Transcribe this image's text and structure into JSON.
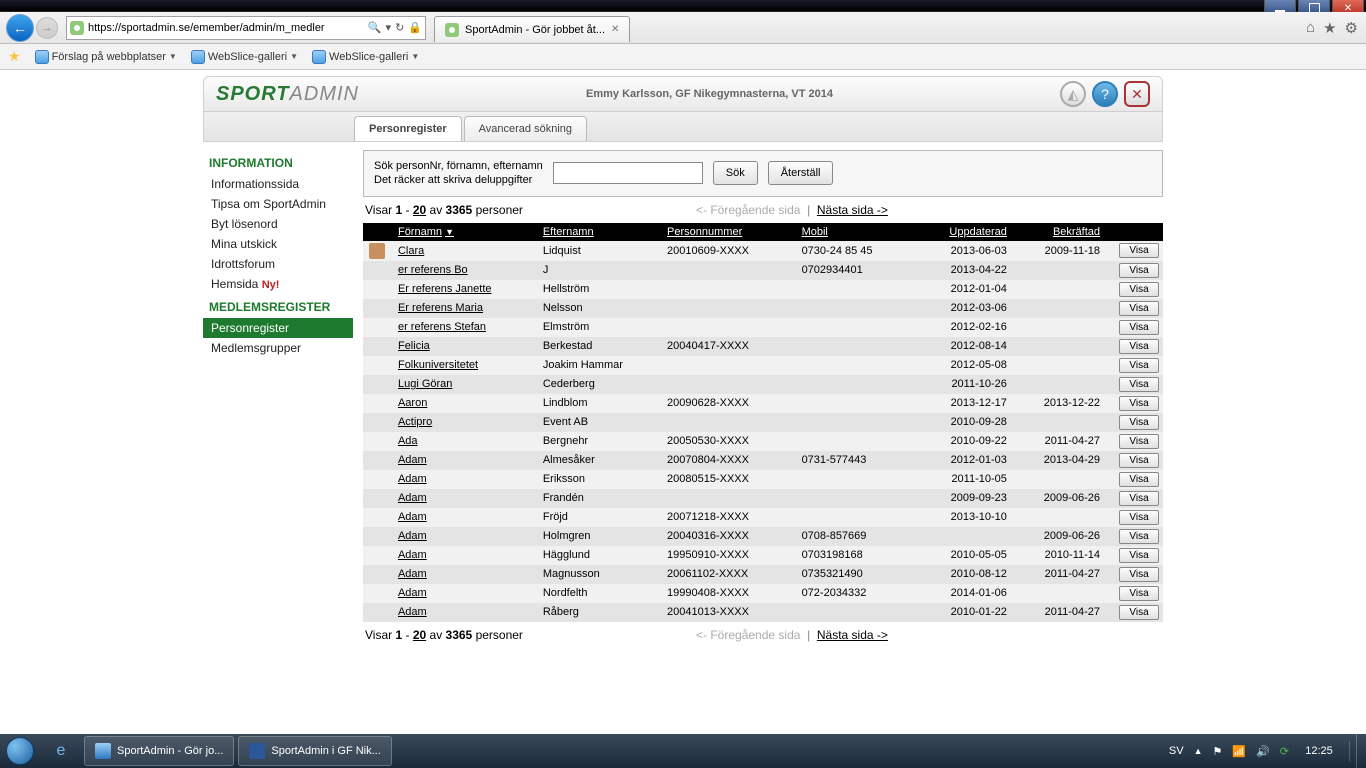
{
  "browser": {
    "url": "https://sportadmin.se/emember/admin/m_medler",
    "tab_title": "SportAdmin - Gör jobbet åt..."
  },
  "favorites": {
    "item1": "Förslag på webbplatser",
    "item2": "WebSlice-galleri",
    "item3": "WebSlice-galleri"
  },
  "header": {
    "logo_a": "SPORT",
    "logo_b": "ADMIN",
    "userline": "Emmy Karlsson, GF Nikegymnasterna, VT 2014"
  },
  "tabs": {
    "t1": "Personregister",
    "t2": "Avancerad sökning"
  },
  "sidebar": {
    "h1": "INFORMATION",
    "i1": "Informationssida",
    "i2": "Tipsa om SportAdmin",
    "i3": "Byt lösenord",
    "i4": "Mina utskick",
    "i5": "Idrottsforum",
    "i6": "Hemsida",
    "i6b": "Ny!",
    "h2": "MEDLEMSREGISTER",
    "i7": "Personregister",
    "i8": "Medlemsgrupper"
  },
  "search": {
    "line1": "Sök personNr, förnamn, efternamn",
    "line2": "Det räcker att skriva deluppgifter",
    "btn_search": "Sök",
    "btn_reset": "Återställ"
  },
  "pager": {
    "visar": "Visar",
    "range_a": "1",
    "dash": " - ",
    "range_b": "20",
    "av": " av ",
    "total": "3365",
    "personer": " personer",
    "prev": "<- Föregående sida",
    "next": "Nästa sida ->"
  },
  "columns": {
    "c1": "Förnamn",
    "c2": "Efternamn",
    "c3": "Personnummer",
    "c4": "Mobil",
    "c5": "Uppdaterad",
    "c6": "Bekräftad"
  },
  "visa_label": "Visa",
  "rows": [
    {
      "av": true,
      "fn": "Clara",
      "en": "Lidquist",
      "pn": "20010609-XXXX",
      "mb": "0730-24 85 45",
      "up": "2013-06-03",
      "bk": "2009-11-18"
    },
    {
      "fn": "er referens Bo",
      "en": "J",
      "pn": "",
      "mb": "0702934401",
      "up": "2013-04-22",
      "bk": ""
    },
    {
      "fn": "Er referens Janette",
      "en": "Hellström",
      "pn": "",
      "mb": "",
      "up": "2012-01-04",
      "bk": ""
    },
    {
      "fn": "Er referens Maria",
      "en": "Nelsson",
      "pn": "",
      "mb": "",
      "up": "2012-03-06",
      "bk": ""
    },
    {
      "fn": "er referens Stefan",
      "en": "Elmström",
      "pn": "",
      "mb": "",
      "up": "2012-02-16",
      "bk": ""
    },
    {
      "fn": "Felicia",
      "en": "Berkestad",
      "pn": "20040417-XXXX",
      "mb": "",
      "up": "2012-08-14",
      "bk": ""
    },
    {
      "fn": "Folkuniversitetet",
      "en": "Joakim Hammar",
      "pn": "",
      "mb": "",
      "up": "2012-05-08",
      "bk": ""
    },
    {
      "fn": "Lugi Göran",
      "en": "Cederberg",
      "pn": "",
      "mb": "",
      "up": "2011-10-26",
      "bk": ""
    },
    {
      "fn": "Aaron",
      "en": "Lindblom",
      "pn": "20090628-XXXX",
      "mb": "",
      "up": "2013-12-17",
      "bk": "2013-12-22"
    },
    {
      "fn": "Actipro",
      "en": "Event AB",
      "pn": "",
      "mb": "",
      "up": "2010-09-28",
      "bk": ""
    },
    {
      "fn": "Ada",
      "en": "Bergnehr",
      "pn": "20050530-XXXX",
      "mb": "",
      "up": "2010-09-22",
      "bk": "2011-04-27"
    },
    {
      "fn": "Adam",
      "en": "Almesåker",
      "pn": "20070804-XXXX",
      "mb": "0731-577443",
      "up": "2012-01-03",
      "bk": "2013-04-29"
    },
    {
      "fn": "Adam",
      "en": "Eriksson",
      "pn": "20080515-XXXX",
      "mb": "",
      "up": "2011-10-05",
      "bk": ""
    },
    {
      "fn": "Adam",
      "en": "Frandén",
      "pn": "",
      "mb": "",
      "up": "2009-09-23",
      "bk": "2009-06-26"
    },
    {
      "fn": "Adam",
      "en": "Fröjd",
      "pn": "20071218-XXXX",
      "mb": "",
      "up": "2013-10-10",
      "bk": ""
    },
    {
      "fn": "Adam",
      "en": "Holmgren",
      "pn": "20040316-XXXX",
      "mb": "0708-857669",
      "up": "",
      "bk": "2009-06-26"
    },
    {
      "fn": "Adam",
      "en": "Hägglund",
      "pn": "19950910-XXXX",
      "mb": "0703198168",
      "up": "2010-05-05",
      "bk": "2010-11-14"
    },
    {
      "fn": "Adam",
      "en": "Magnusson",
      "pn": "20061102-XXXX",
      "mb": "0735321490",
      "up": "2010-08-12",
      "bk": "2011-04-27"
    },
    {
      "fn": "Adam",
      "en": "Nordfelth",
      "pn": "19990408-XXXX",
      "mb": "072-2034332",
      "up": "2014-01-06",
      "bk": ""
    },
    {
      "fn": "Adam",
      "en": "Råberg",
      "pn": "20041013-XXXX",
      "mb": "",
      "up": "2010-01-22",
      "bk": "2011-04-27"
    }
  ],
  "taskbar": {
    "task1": "SportAdmin - Gör jo...",
    "task2": "SportAdmin i GF Nik...",
    "lang": "SV",
    "clock": "12:25"
  }
}
